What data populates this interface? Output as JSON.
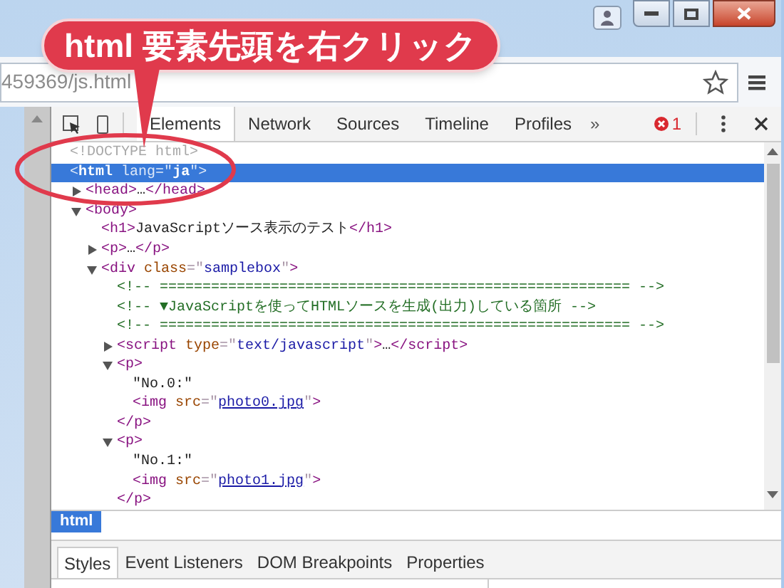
{
  "address_bar": {
    "url": "459369/js.html"
  },
  "devtools": {
    "tabs": [
      {
        "label": "Elements",
        "selected": true
      },
      {
        "label": "Network",
        "selected": false
      },
      {
        "label": "Sources",
        "selected": false
      },
      {
        "label": "Timeline",
        "selected": false
      },
      {
        "label": "Profiles",
        "selected": false
      }
    ],
    "more_tabs": "»",
    "error_count": "1",
    "dom_tree": [
      {
        "selected": false,
        "tokens": [
          {
            "kind": "doctype",
            "text": "<!DOCTYPE html>"
          }
        ]
      },
      {
        "selected": true,
        "tokens": [
          {
            "kind": "punct",
            "text": "<"
          },
          {
            "kind": "tag",
            "text": "html"
          },
          {
            "kind": "attr",
            "text": " lang"
          },
          {
            "kind": "punct",
            "text": "=\""
          },
          {
            "kind": "value",
            "text": "ja"
          },
          {
            "kind": "punct",
            "text": "\">"
          }
        ],
        "children": [
          {
            "selected": false,
            "expanded": false,
            "tokens": [
              {
                "kind": "tag",
                "text": "<head>"
              },
              {
                "kind": "text",
                "text": "…"
              },
              {
                "kind": "tag",
                "text": "</head>"
              }
            ]
          },
          {
            "selected": false,
            "expanded": true,
            "tokens": [
              {
                "kind": "tag",
                "text": "<body>"
              }
            ],
            "children": [
              {
                "selected": false,
                "tokens": [
                  {
                    "kind": "tag",
                    "text": "<h1>"
                  },
                  {
                    "kind": "text",
                    "text": "JavaScriptソース表示のテスト"
                  },
                  {
                    "kind": "tag",
                    "text": "</h1>"
                  }
                ]
              },
              {
                "selected": false,
                "expanded": false,
                "tokens": [
                  {
                    "kind": "tag",
                    "text": "<p>"
                  },
                  {
                    "kind": "text",
                    "text": "…"
                  },
                  {
                    "kind": "tag",
                    "text": "</p>"
                  }
                ]
              },
              {
                "selected": false,
                "expanded": true,
                "tokens": [
                  {
                    "kind": "tag",
                    "text": "<div"
                  },
                  {
                    "kind": "attr",
                    "text": " class"
                  },
                  {
                    "kind": "punct",
                    "text": "=\""
                  },
                  {
                    "kind": "value",
                    "text": "samplebox"
                  },
                  {
                    "kind": "punct",
                    "text": "\""
                  },
                  {
                    "kind": "tag",
                    "text": ">"
                  }
                ],
                "children": [
                  {
                    "selected": false,
                    "tokens": [
                      {
                        "kind": "comment",
                        "text": "<!-- ======================================================= -->"
                      }
                    ]
                  },
                  {
                    "selected": false,
                    "tokens": [
                      {
                        "kind": "comment",
                        "text": "<!-- ▼JavaScriptを使ってHTMLソースを生成(出力)している箇所 -->"
                      }
                    ]
                  },
                  {
                    "selected": false,
                    "tokens": [
                      {
                        "kind": "comment",
                        "text": "<!-- ======================================================= -->"
                      }
                    ]
                  },
                  {
                    "selected": false,
                    "expanded": false,
                    "tokens": [
                      {
                        "kind": "tag",
                        "text": "<script"
                      },
                      {
                        "kind": "attr",
                        "text": " type"
                      },
                      {
                        "kind": "punct",
                        "text": "=\""
                      },
                      {
                        "kind": "value",
                        "text": "text/javascript"
                      },
                      {
                        "kind": "punct",
                        "text": "\""
                      },
                      {
                        "kind": "tag",
                        "text": ">"
                      },
                      {
                        "kind": "text",
                        "text": "…"
                      },
                      {
                        "kind": "tag",
                        "text": "</script>"
                      }
                    ]
                  },
                  {
                    "selected": false,
                    "expanded": true,
                    "tokens": [
                      {
                        "kind": "tag",
                        "text": "<p>"
                      }
                    ],
                    "children": [
                      {
                        "selected": false,
                        "tokens": [
                          {
                            "kind": "text",
                            "text": "\"No.0:\""
                          }
                        ]
                      },
                      {
                        "selected": false,
                        "tokens": [
                          {
                            "kind": "tag",
                            "text": "<img"
                          },
                          {
                            "kind": "attr",
                            "text": " src"
                          },
                          {
                            "kind": "punct",
                            "text": "=\""
                          },
                          {
                            "kind": "link",
                            "text": "photo0.jpg"
                          },
                          {
                            "kind": "punct",
                            "text": "\""
                          },
                          {
                            "kind": "tag",
                            "text": ">"
                          }
                        ]
                      }
                    ]
                  },
                  {
                    "selected": false,
                    "tokens": [
                      {
                        "kind": "tag",
                        "text": "</p>"
                      }
                    ]
                  },
                  {
                    "selected": false,
                    "expanded": true,
                    "tokens": [
                      {
                        "kind": "tag",
                        "text": "<p>"
                      }
                    ],
                    "children": [
                      {
                        "selected": false,
                        "tokens": [
                          {
                            "kind": "text",
                            "text": "\"No.1:\""
                          }
                        ]
                      },
                      {
                        "selected": false,
                        "tokens": [
                          {
                            "kind": "tag",
                            "text": "<img"
                          },
                          {
                            "kind": "attr",
                            "text": " src"
                          },
                          {
                            "kind": "punct",
                            "text": "=\""
                          },
                          {
                            "kind": "link",
                            "text": "photo1.jpg"
                          },
                          {
                            "kind": "punct",
                            "text": "\""
                          },
                          {
                            "kind": "tag",
                            "text": ">"
                          }
                        ]
                      }
                    ]
                  },
                  {
                    "selected": false,
                    "tokens": [
                      {
                        "kind": "tag",
                        "text": "</p>"
                      }
                    ]
                  }
                ]
              }
            ]
          }
        ]
      }
    ],
    "breadcrumb": [
      {
        "label": "html",
        "selected": true
      }
    ],
    "sidebar_tabs": [
      {
        "label": "Styles",
        "selected": true
      },
      {
        "label": "Event Listeners",
        "selected": false
      },
      {
        "label": "DOM Breakpoints",
        "selected": false
      },
      {
        "label": "Properties",
        "selected": false
      }
    ]
  },
  "callout": {
    "text": "html 要素先頭を右クリック"
  }
}
